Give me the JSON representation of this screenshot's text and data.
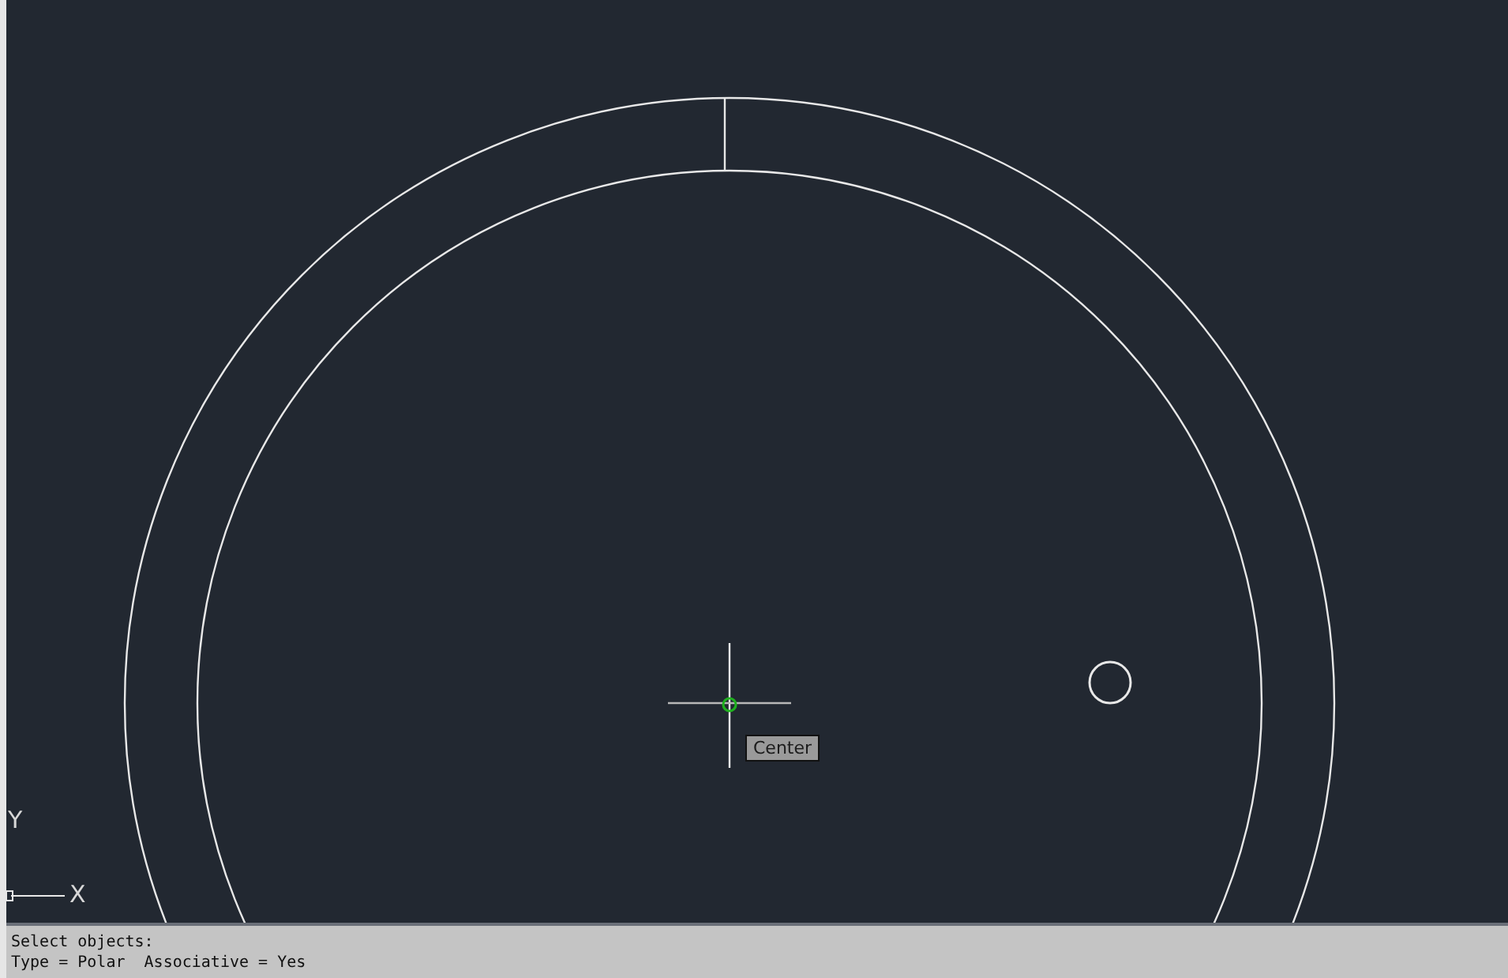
{
  "drawing_area": {
    "snap_tooltip": "Center",
    "ucs_axes": {
      "x_label": "X",
      "y_label": "Y"
    }
  },
  "command_line": {
    "lines": [
      "Select objects:",
      "Type = Polar  Associative = Yes"
    ]
  }
}
